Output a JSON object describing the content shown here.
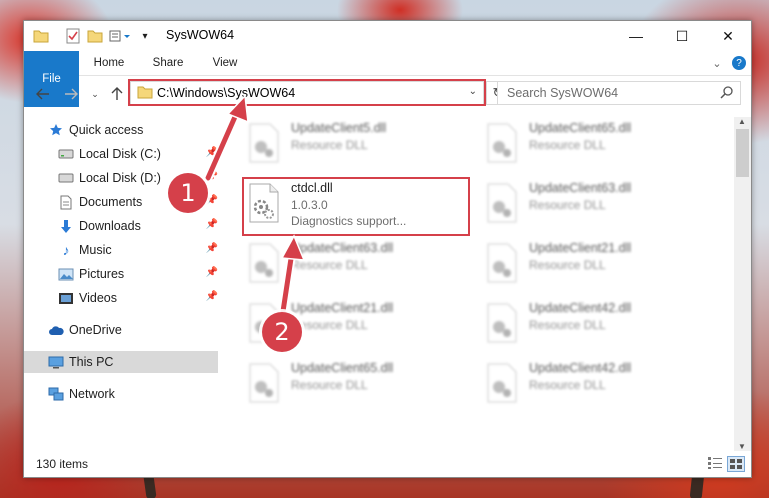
{
  "window": {
    "title": "SysWOW64",
    "controls": {
      "minimize": "—",
      "maximize": "☐",
      "close": "✕"
    }
  },
  "ribbon": {
    "tabs": [
      "File",
      "Home",
      "Share",
      "View"
    ],
    "expand_icon": "chevron-down-icon",
    "help_icon": "?"
  },
  "navigation": {
    "address": "C:\\Windows\\SysWOW64",
    "search_placeholder": "Search SysWOW64"
  },
  "sidebar": {
    "quick_access": "Quick access",
    "items": [
      {
        "label": "Local Disk (C:)",
        "icon": "drive-icon",
        "pinned": true
      },
      {
        "label": "Local Disk (D:)",
        "icon": "drive-icon",
        "pinned": true
      },
      {
        "label": "Documents",
        "icon": "documents-icon",
        "pinned": true
      },
      {
        "label": "Downloads",
        "icon": "downloads-icon",
        "pinned": true
      },
      {
        "label": "Music",
        "icon": "music-icon",
        "pinned": true
      },
      {
        "label": "Pictures",
        "icon": "pictures-icon",
        "pinned": true
      },
      {
        "label": "Videos",
        "icon": "videos-icon",
        "pinned": true
      }
    ],
    "onedrive": "OneDrive",
    "this_pc": "This PC",
    "network": "Network"
  },
  "files": {
    "left_column": [
      {
        "name": "UpdateClient5.dll",
        "type": "Resource DLL"
      },
      {
        "name": "ctdcl.dll",
        "version": "1.0.3.0",
        "desc": "Diagnostics support..."
      },
      {
        "name": "UpdateClient63.dll",
        "type": "Resource DLL"
      },
      {
        "name": "UpdateClient21.dll",
        "type": "Resource DLL"
      },
      {
        "name": "UpdateClient65.dll",
        "type": "Resource DLL"
      }
    ],
    "right_column": [
      {
        "name": "UpdateClient65.dll",
        "type": "Resource DLL"
      },
      {
        "name": "UpdateClient63.dll",
        "type": "Resource DLL"
      },
      {
        "name": "UpdateClient21.dll",
        "type": "Resource DLL"
      },
      {
        "name": "UpdateClient42.dll",
        "type": "Resource DLL"
      },
      {
        "name": "UpdateClient42.dll",
        "type": "Resource DLL"
      }
    ]
  },
  "status": {
    "item_count": "130 items"
  },
  "callouts": {
    "one": "1",
    "two": "2"
  },
  "colors": {
    "accent": "#1979ca",
    "callout": "#d5404a",
    "selected": "#d9d9d9"
  }
}
